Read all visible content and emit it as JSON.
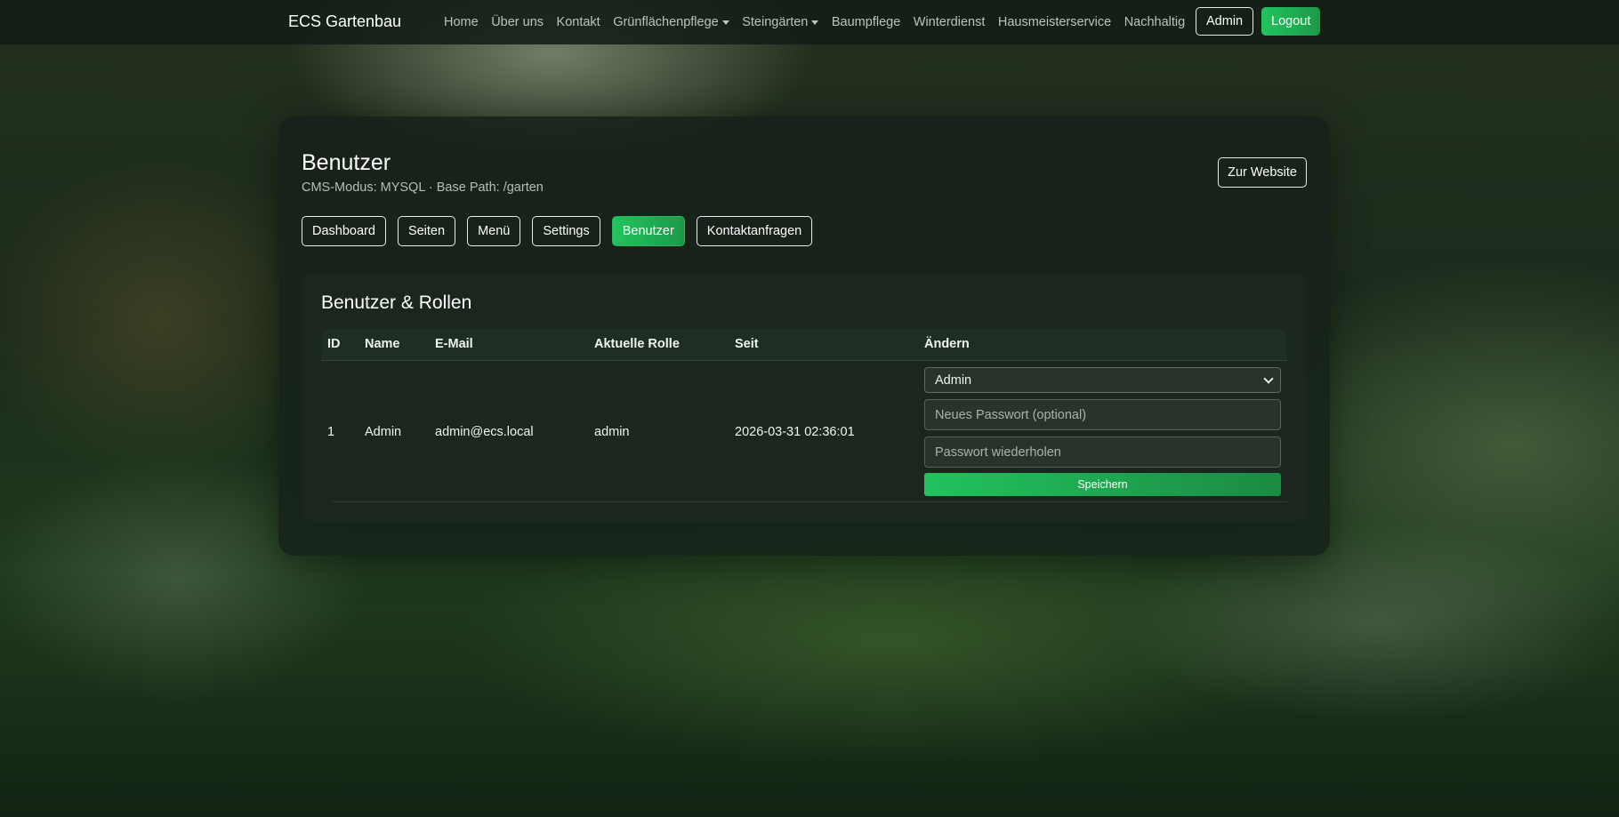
{
  "navbar": {
    "brand": "ECS Gartenbau",
    "links": [
      {
        "label": "Home"
      },
      {
        "label": "Über uns"
      },
      {
        "label": "Kontakt"
      },
      {
        "label": "Grünflächenpflege",
        "dropdown": true
      },
      {
        "label": "Steingärten",
        "dropdown": true
      },
      {
        "label": "Baumpflege"
      },
      {
        "label": "Winterdienst"
      },
      {
        "label": "Hausmeisterservice"
      },
      {
        "label": "Nachhaltig"
      }
    ],
    "admin_label": "Admin",
    "logout_label": "Logout"
  },
  "header": {
    "title": "Benutzer",
    "subtitle": "CMS-Modus: MYSQL · Base Path: /garten",
    "website_button": "Zur Website"
  },
  "tabs": [
    {
      "label": "Dashboard",
      "active": false
    },
    {
      "label": "Seiten",
      "active": false
    },
    {
      "label": "Menü",
      "active": false
    },
    {
      "label": "Settings",
      "active": false
    },
    {
      "label": "Benutzer",
      "active": true
    },
    {
      "label": "Kontaktanfragen",
      "active": false
    }
  ],
  "users_card": {
    "title": "Benutzer & Rollen",
    "columns": [
      "ID",
      "Name",
      "E-Mail",
      "Aktuelle Rolle",
      "Seit",
      "Ändern"
    ],
    "rows": [
      {
        "id": "1",
        "name": "Admin",
        "email": "admin@ecs.local",
        "role": "admin",
        "since": "2026-03-31 02:36:01",
        "role_select": "Admin",
        "new_password_placeholder": "Neues Passwort (optional)",
        "repeat_password_placeholder": "Passwort wiederholen",
        "save_label": "Speichern"
      }
    ]
  },
  "colors": {
    "accent_green": "#22c35e",
    "panel_bg": "#16221a"
  },
  "icons": {
    "dropdown_caret": "caret-down-icon",
    "select_chevron": "chevron-down-icon"
  }
}
